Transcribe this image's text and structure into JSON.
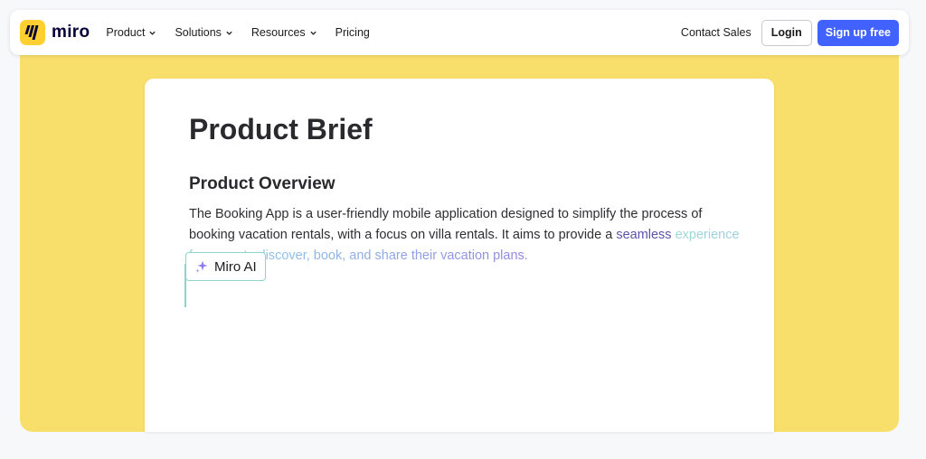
{
  "brand": {
    "name": "miro"
  },
  "nav": {
    "items": [
      {
        "label": "Product",
        "has_dropdown": true
      },
      {
        "label": "Solutions",
        "has_dropdown": true
      },
      {
        "label": "Resources",
        "has_dropdown": true
      },
      {
        "label": "Pricing",
        "has_dropdown": false
      }
    ],
    "contact_label": "Contact Sales",
    "login_label": "Login",
    "signup_label": "Sign up free"
  },
  "document": {
    "title": "Product Brief",
    "section_heading": "Product Overview",
    "body_plain": "The Booking App is a user-friendly mobile application designed to simplify the process of booking vacation rentals, with a focus on villa rentals. It aims to provide a ",
    "body_generating_a": "seamless",
    "body_generating_b": " experience for users to discover, book, and share their vacation plans."
  },
  "ai_badge": {
    "label": "Miro AI",
    "icon": "sparkle-icon"
  },
  "colors": {
    "brand_yellow": "#ffd02f",
    "hero_yellow": "#f8df6b",
    "primary_button": "#4262ff",
    "ai_accent": "#8fd3cf"
  }
}
